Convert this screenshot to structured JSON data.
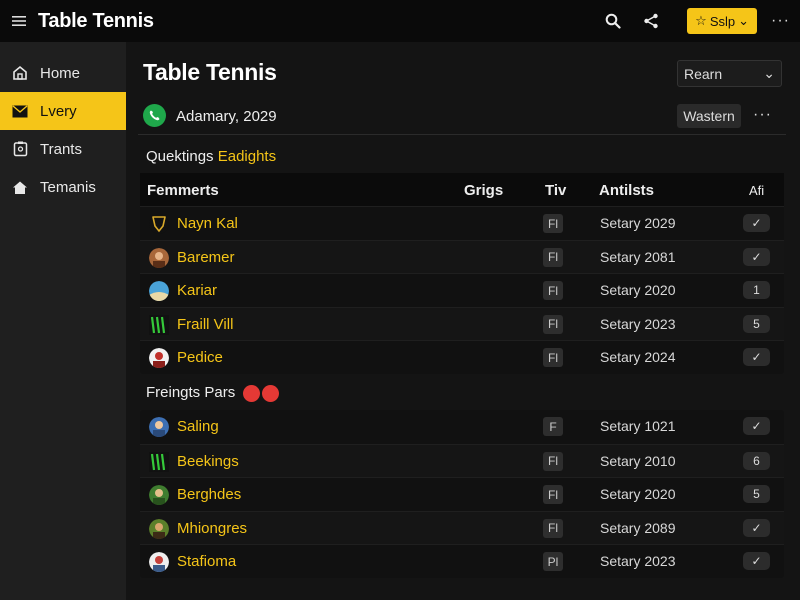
{
  "topbar": {
    "title": "Table Tennis",
    "skip_label": "Sslp",
    "skip_icon": "star-icon",
    "more_label": "···"
  },
  "sidebar": {
    "items": [
      {
        "label": "Home",
        "icon": "home-icon",
        "active": false
      },
      {
        "label": "Lvery",
        "icon": "mail-icon",
        "active": true
      },
      {
        "label": "Trants",
        "icon": "bookmark-icon",
        "active": false
      },
      {
        "label": "Temanis",
        "icon": "house-icon",
        "active": false
      }
    ]
  },
  "main": {
    "title": "Table Tennis",
    "sort_select": "Rearn",
    "header_label": "Adamary, 2029",
    "western_label": "Wastern",
    "more_label": "···",
    "section1": {
      "prefix": "Quektings ",
      "accent": "Eadights"
    },
    "table_headers": {
      "name": "Femmerts",
      "grigs": "Grigs",
      "tiv": "Tiv",
      "antilists": "Antilsts",
      "afi": "Afi"
    },
    "rows1": [
      {
        "name": "Nayn Kal",
        "tiv": "Fl",
        "date": "Setary 2029",
        "badge": "✓"
      },
      {
        "name": "Baremer",
        "tiv": "Fl",
        "date": "Setary 2081",
        "badge": "✓"
      },
      {
        "name": "Kariar",
        "tiv": "Fl",
        "date": "Setary 2020",
        "badge": "1"
      },
      {
        "name": "Fraill Vill",
        "tiv": "Fl",
        "date": "Setary 2023",
        "badge": "5"
      },
      {
        "name": "Pedice",
        "tiv": "Fl",
        "date": "Setary 2024",
        "badge": "✓"
      }
    ],
    "section2": {
      "label": "Freingts Pars"
    },
    "rows2": [
      {
        "name": "Saling",
        "tiv": "F",
        "date": "Setary 1021",
        "badge": "✓"
      },
      {
        "name": "Beekings",
        "tiv": "Fl",
        "date": "Setary 2010",
        "badge": "6"
      },
      {
        "name": "Berghdes",
        "tiv": "Fl",
        "date": "Setary 2020",
        "badge": "5"
      },
      {
        "name": "Mhiongres",
        "tiv": "Fl",
        "date": "Setary 2089",
        "badge": "✓"
      },
      {
        "name": "Stafioma",
        "tiv": "Pl",
        "date": "Setary 2023",
        "badge": "✓"
      }
    ]
  },
  "colors": {
    "accent": "#f5c518",
    "status_green": "#1fa84b",
    "status_red": "#e53935"
  }
}
